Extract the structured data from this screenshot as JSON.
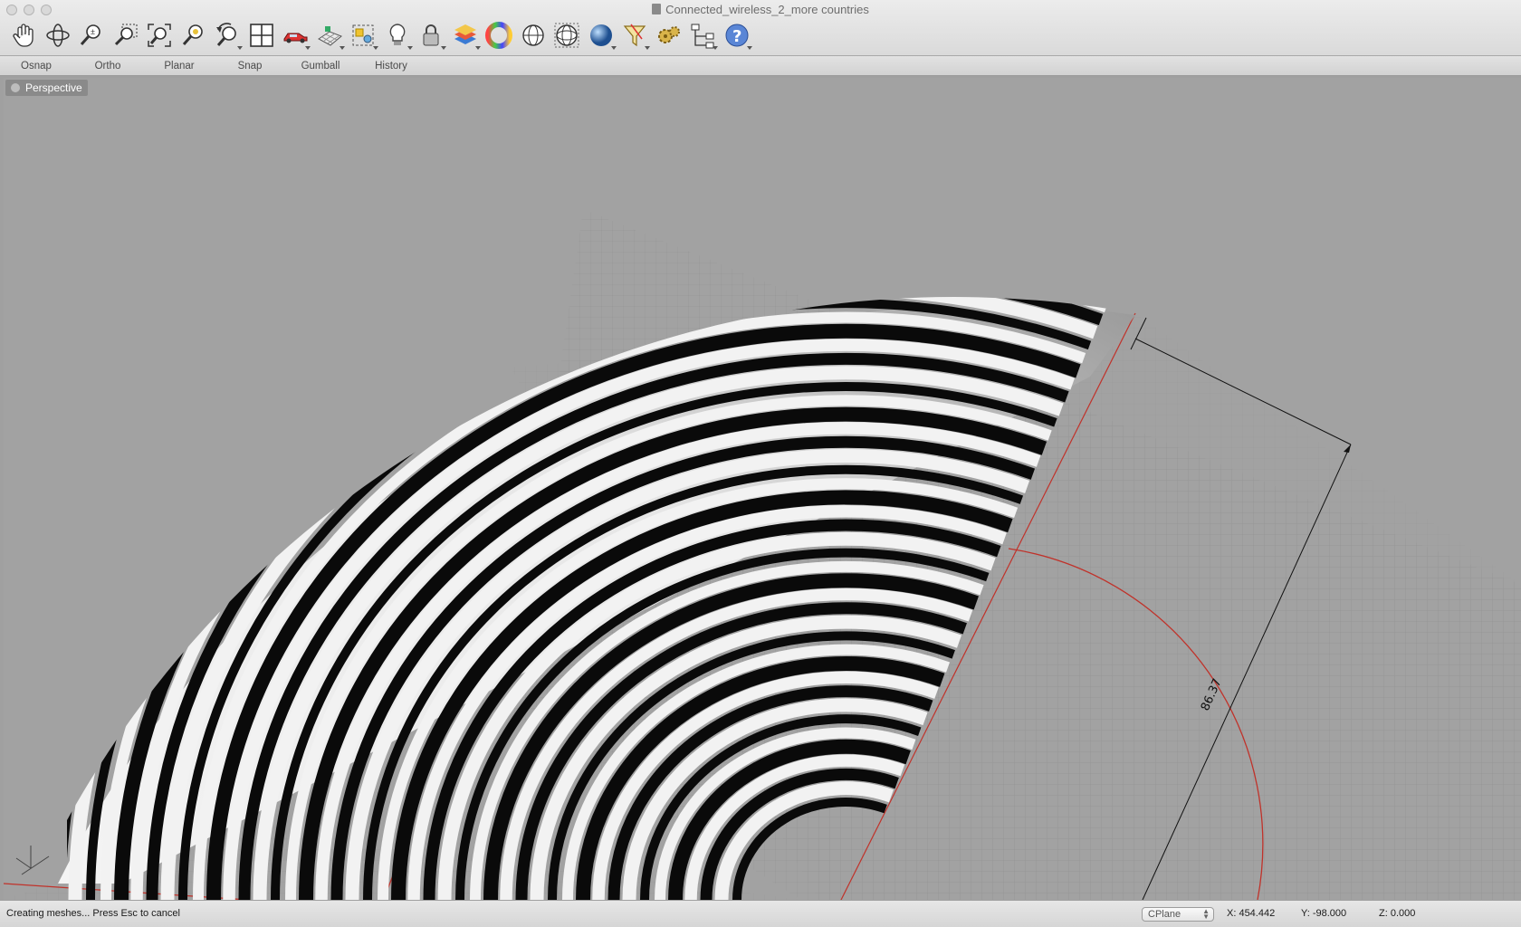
{
  "window": {
    "title": "Connected_wireless_2_more countries"
  },
  "toolbar": {
    "tools": [
      {
        "name": "pan-icon",
        "dd": false
      },
      {
        "name": "rotate-view-icon",
        "dd": false
      },
      {
        "name": "zoom-dynamic-icon",
        "dd": false
      },
      {
        "name": "zoom-window-icon",
        "dd": false
      },
      {
        "name": "zoom-extents-icon",
        "dd": false
      },
      {
        "name": "zoom-selected-icon",
        "dd": false
      },
      {
        "name": "undo-view-icon",
        "dd": true
      },
      {
        "name": "four-viewports-icon",
        "dd": false
      },
      {
        "name": "render-car-icon",
        "dd": true
      },
      {
        "name": "cplane-grid-icon",
        "dd": true
      },
      {
        "name": "select-objects-icon",
        "dd": true
      },
      {
        "name": "light-bulb-icon",
        "dd": true
      },
      {
        "name": "lock-icon",
        "dd": true
      },
      {
        "name": "layer-icon",
        "dd": true
      },
      {
        "name": "color-wheel-icon",
        "dd": false
      },
      {
        "name": "sphere-wireframe-icon",
        "dd": false
      },
      {
        "name": "sphere-grid-icon",
        "dd": false
      },
      {
        "name": "sphere-shaded-icon",
        "dd": true
      },
      {
        "name": "filter-icon",
        "dd": true
      },
      {
        "name": "gears-icon",
        "dd": false
      },
      {
        "name": "hierarchy-icon",
        "dd": true
      },
      {
        "name": "help-icon",
        "dd": true
      }
    ]
  },
  "modes": [
    {
      "label": "Osnap",
      "on": true
    },
    {
      "label": "Ortho",
      "on": false
    },
    {
      "label": "Planar",
      "on": false
    },
    {
      "label": "Snap",
      "on": false
    },
    {
      "label": "Gumball",
      "on": false
    },
    {
      "label": "History",
      "on": false
    }
  ],
  "viewport": {
    "name": "Perspective",
    "dimension_label": "86.37"
  },
  "status": {
    "prompt": "Creating meshes... Press Esc to cancel",
    "cplane": "CPlane",
    "x": "X: 454.442",
    "y": "Y: -98.000",
    "z": "Z: 0.000"
  }
}
